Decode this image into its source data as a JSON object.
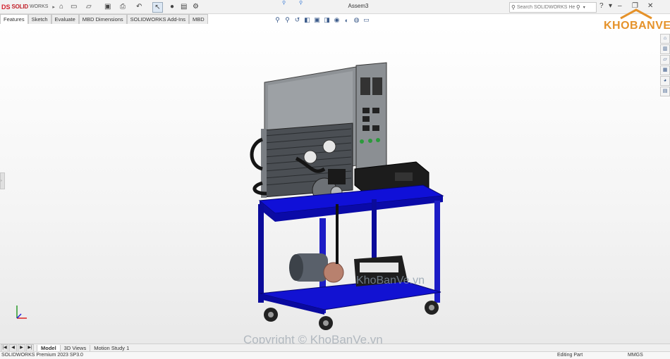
{
  "app": {
    "name_part1": "DS",
    "name_part2": "SOLID",
    "name_part3": "WORKS",
    "document_title": "Assem3"
  },
  "search": {
    "placeholder": "Search SOLIDWORKS Help"
  },
  "tabs": [
    {
      "label": "Features"
    },
    {
      "label": "Sketch"
    },
    {
      "label": "Evaluate"
    },
    {
      "label": "MBD Dimensions"
    },
    {
      "label": "SOLIDWORKS Add-Ins"
    },
    {
      "label": "MBD"
    }
  ],
  "bottom_tabs": [
    {
      "label": "Model"
    },
    {
      "label": "3D Views"
    },
    {
      "label": "Motion Study 1"
    }
  ],
  "status": {
    "version": "SOLIDWORKS Premium 2023 SP3.0",
    "mode": "Editing Part",
    "units": "MMGS"
  },
  "watermarks": {
    "brand": "KHOBANVE",
    "center": "KhoBanVe.vn",
    "bottom": "Copyright © KhoBanVe.vn"
  },
  "icons": {
    "quick_access": [
      "home-icon",
      "new-icon",
      "open-icon",
      "print-icon",
      "undo-icon",
      "select-icon",
      "rebuild-icon",
      "file-properties-icon",
      "options-icon"
    ],
    "view": [
      "zoom-to-fit-icon",
      "zoom-area-icon",
      "previous-view-icon",
      "section-view-icon",
      "view-orientation-icon",
      "display-style-icon",
      "hide-show-icon",
      "edit-appearance-icon",
      "apply-scene-icon",
      "view-settings-icon"
    ],
    "task_pane": [
      "solidworks-resources-icon",
      "design-library-icon",
      "file-explorer-icon",
      "view-palette-icon",
      "appearances-icon",
      "custom-properties-icon"
    ]
  }
}
